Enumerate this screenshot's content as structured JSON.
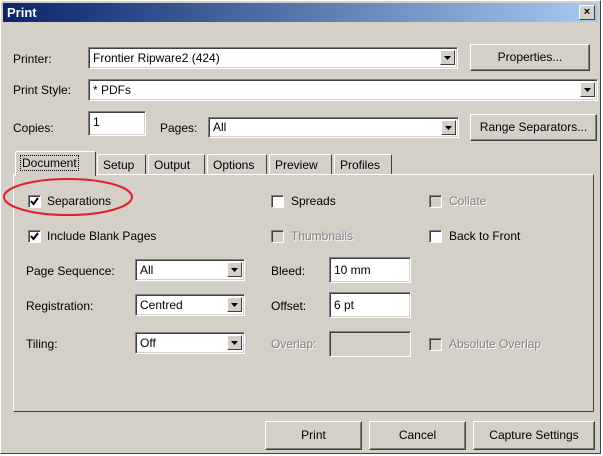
{
  "window": {
    "title": "Print",
    "close_glyph": "×"
  },
  "printer": {
    "label": "Printer:",
    "value": "Frontier Ripware2 (424)",
    "properties_button": "Properties..."
  },
  "print_style": {
    "label": "Print Style:",
    "value": "* PDFs"
  },
  "copies": {
    "label": "Copies:",
    "value": "1"
  },
  "pages": {
    "label": "Pages:",
    "value": "All",
    "range_button": "Range Separators..."
  },
  "tabs": [
    {
      "label": "Document",
      "active": true
    },
    {
      "label": "Setup",
      "active": false
    },
    {
      "label": "Output",
      "active": false
    },
    {
      "label": "Options",
      "active": false
    },
    {
      "label": "Preview",
      "active": false
    },
    {
      "label": "Profiles",
      "active": false
    }
  ],
  "options": {
    "separations": {
      "label": "Separations",
      "checked": true,
      "highlighted": true
    },
    "spreads": {
      "label": "Spreads",
      "checked": false
    },
    "collate": {
      "label": "Collate",
      "checked": false,
      "disabled": true
    },
    "include_blank_pages": {
      "label": "Include Blank Pages",
      "checked": true
    },
    "thumbnails": {
      "label": "Thumbnails",
      "checked": false,
      "disabled": true
    },
    "back_to_front": {
      "label": "Back to Front",
      "checked": false
    },
    "absolute_overlap": {
      "label": "Absolute Overlap",
      "checked": false,
      "disabled": true
    }
  },
  "page_sequence": {
    "label": "Page Sequence:",
    "value": "All"
  },
  "registration": {
    "label": "Registration:",
    "value": "Centred"
  },
  "tiling": {
    "label": "Tiling:",
    "value": "Off"
  },
  "bleed": {
    "label": "Bleed:",
    "value": "10 mm"
  },
  "offset": {
    "label": "Offset:",
    "value": "6 pt"
  },
  "overlap": {
    "label": "Overlap:",
    "value": ""
  },
  "buttons": {
    "print": "Print",
    "cancel": "Cancel",
    "capture": "Capture Settings"
  },
  "colors": {
    "titlebar_start": "#0a246a",
    "titlebar_end": "#a6caf0",
    "highlight_circle": "#e0202a",
    "face": "#d4d0c8"
  }
}
